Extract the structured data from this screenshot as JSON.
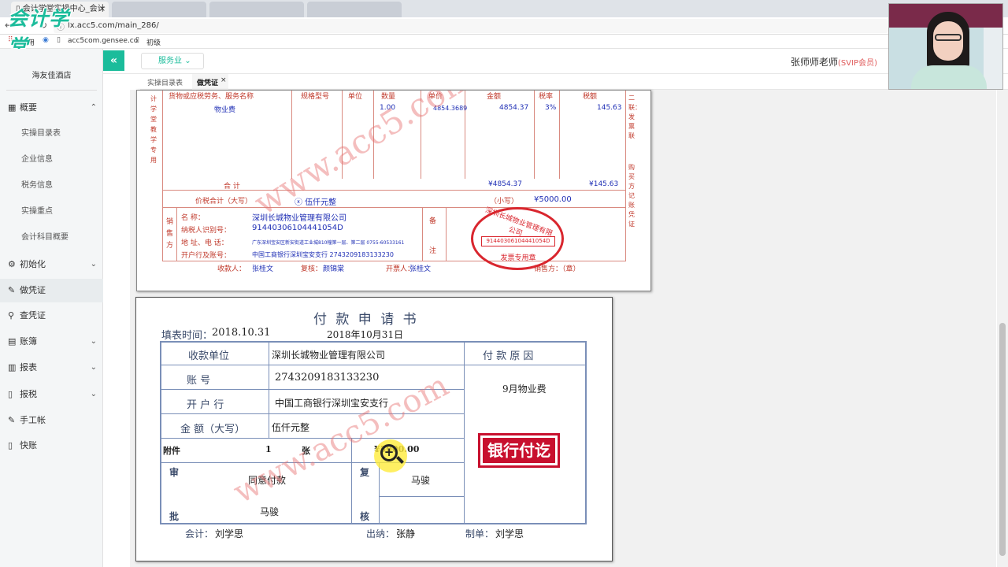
{
  "browser": {
    "tabs": [
      {
        "title": "会计学堂实操中心_会计"
      },
      {
        "title": ""
      },
      {
        "title": ""
      },
      {
        "title": ""
      }
    ],
    "url": "lx.acc5.com/main_286/",
    "bookmarks": [
      {
        "label": "应用"
      },
      {
        "label": "acc5com.gensee.co"
      },
      {
        "label": "初级"
      }
    ]
  },
  "brand": {
    "logo_text": "会计学堂"
  },
  "sidebar": {
    "company": "海友佳酒店",
    "items": [
      {
        "label": "概要",
        "icon": "grid-icon",
        "chev": "⌃"
      },
      {
        "label": "实操目录表"
      },
      {
        "label": "企业信息"
      },
      {
        "label": "税务信息"
      },
      {
        "label": "实操重点"
      },
      {
        "label": "会计科目概要"
      },
      {
        "label": "初始化",
        "icon": "gear-icon",
        "chev": "⌄"
      },
      {
        "label": "做凭证",
        "icon": "pen-icon"
      },
      {
        "label": "查凭证",
        "icon": "search-icon"
      },
      {
        "label": "账簿",
        "icon": "book-icon",
        "chev": "⌄"
      },
      {
        "label": "报表",
        "icon": "report-icon",
        "chev": "⌄"
      },
      {
        "label": "报税",
        "icon": "file-icon",
        "chev": "⌄"
      },
      {
        "label": "手工帐",
        "icon": "pen-icon"
      },
      {
        "label": "快账",
        "icon": "file-icon"
      }
    ]
  },
  "topnav": {
    "collapse_icon": "«",
    "industry": "服务业",
    "user_name": "张师师老师",
    "membership": "(SVIP会员)"
  },
  "tabs": [
    {
      "label": "实操目录表"
    },
    {
      "label": "做凭证",
      "close": "×"
    }
  ],
  "invoice": {
    "side_left": "计学堂教学专用",
    "side_right_top": "二联：发票联",
    "side_right_bottom": "购买方记账凭证",
    "header": {
      "item": "货物或应税劳务、服务名称",
      "spec": "规格型号",
      "unit": "单位",
      "qty": "数量",
      "price": "单价",
      "amount": "金额",
      "rate": "税率",
      "tax": "税额"
    },
    "row": {
      "item": "物业费",
      "qty": "1.00",
      "price": "4854.3689",
      "amount": "4854.37",
      "rate": "3%",
      "tax": "145.63"
    },
    "total_label": "合 计",
    "total_amount": "¥4854.37",
    "total_tax": "¥145.63",
    "sum_label": "价税合计（大写）",
    "sum_words": "ⓧ 伍仟元整",
    "sum_small_label": "（小写）",
    "sum_small": "¥5000.00",
    "seller_label": "销售方",
    "seller_name_label": "名        称：",
    "seller_name": "深圳长城物业管理有限公司",
    "seller_tax_label": "纳税人识别号：",
    "seller_tax": "91440306104441054D",
    "seller_addr_label": "地  址、电  话：",
    "seller_addr": "广东深圳宝安区新安街道工业城810幢第一层、第二层 0755-60533161",
    "seller_bank_label": "开户行及账号：",
    "seller_bank": "中国工商银行深圳宝安支行 2743209183133230",
    "remark_label_1": "备",
    "remark_label_2": "注",
    "payee_label": "收款人：",
    "payee": "张桂文",
    "reviewer_label": "复核：",
    "reviewer": "颜锦棠",
    "drawer_label": "开票人：",
    "drawer": "张桂文",
    "seller_sign_label": "销售方：（章）",
    "seal_text": "深圳长城物业管理有限公司",
    "seal_id": "91440306104441054D",
    "seal_bottom": "发票专用章"
  },
  "payment": {
    "title": "付 款 申 请 书",
    "fill_time_label": "填表时间：",
    "fill_time": "2018.10.31",
    "fill_date": "2018年10月31日",
    "payee_unit_label": "收款单位",
    "payee_unit": "深圳长城物业管理有限公司",
    "account_label": "账          号",
    "account": "2743209183133230",
    "bank_label": "开    户    行",
    "bank": "中国工商银行深圳宝安支行",
    "amount_label": "金 额（大写）",
    "amount_words": "伍仟元整",
    "reason_label": "付    款    原    因",
    "reason": "9月物业费",
    "attach_label": "附件",
    "attach_count": "1",
    "attach_unit": "张",
    "amount_small": "¥5000.00",
    "approve_label_1": "审",
    "approve_label_2": "批",
    "approve_text": "同意付款",
    "approver": "马骏",
    "review_label_1": "复",
    "review_label_2": "核",
    "reviewer": "马骏",
    "stamp": "银行付讫",
    "accountant_label": "会计：",
    "accountant": "刘学思",
    "cashier_label": "出纳：",
    "cashier": "张静",
    "maker_label": "制单：",
    "maker": "刘学思"
  },
  "watermark": "www.acc5.com",
  "colors": {
    "brand_green": "#1bbc9b",
    "invoice_red": "#c0392b",
    "invoice_blue": "#1f2fb5",
    "stamp_red": "#c8102e"
  }
}
